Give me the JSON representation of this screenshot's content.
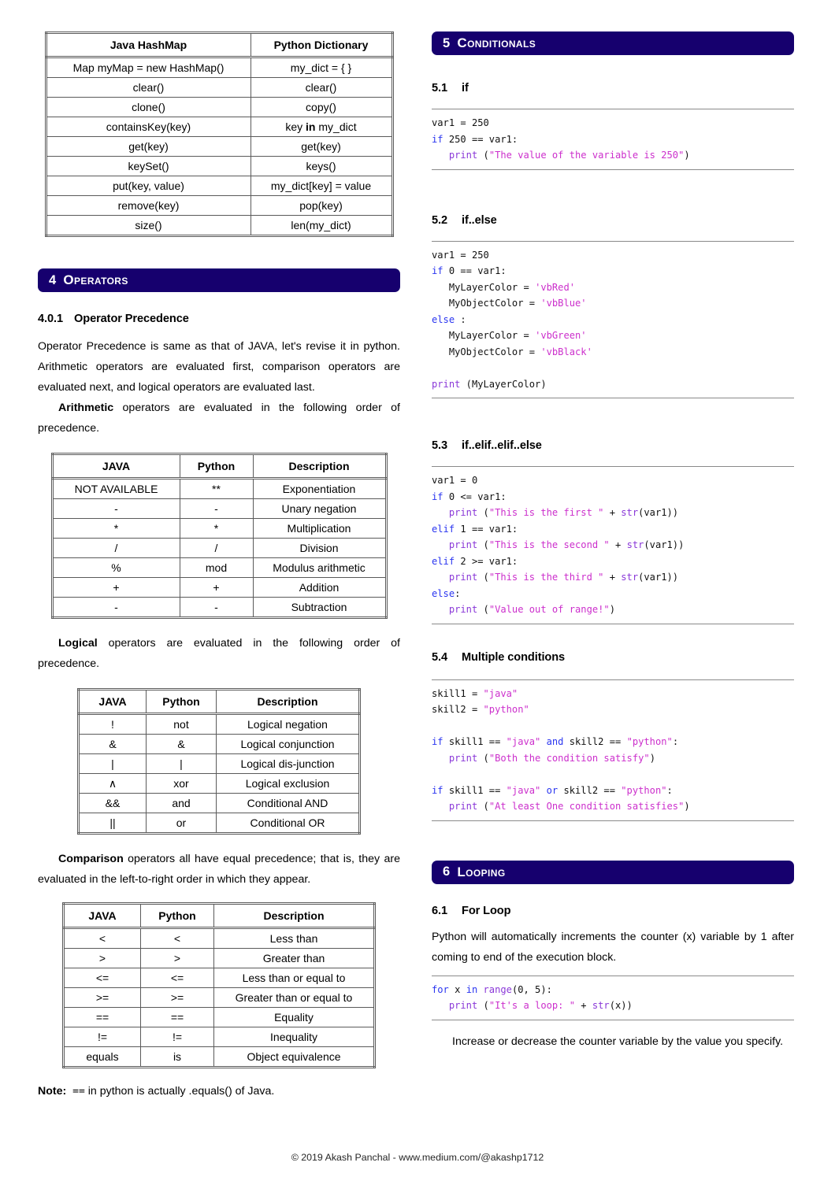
{
  "theme": {
    "header_bar_color": "#16006e",
    "header_text_color": "#ffffff",
    "code_keyword_color": "#2a35f0",
    "code_builtin_color": "#8a38d8",
    "code_string_color": "#cc2fcc",
    "table_border_color": "#5a5a5a"
  },
  "hashmap_table": {
    "headers": [
      "Java HashMap",
      "Python Dictionary"
    ],
    "rows": [
      [
        "Map myMap = new HashMap()",
        "my_dict = { }"
      ],
      [
        "clear()",
        "clear()"
      ],
      [
        "clone()",
        "copy()"
      ],
      [
        "containsKey(key)",
        "key in my_dict"
      ],
      [
        "get(key)",
        "get(key)"
      ],
      [
        "keySet()",
        "keys()"
      ],
      [
        "put(key, value)",
        "my_dict[key] = value"
      ],
      [
        "remove(key)",
        "pop(key)"
      ],
      [
        "size()",
        "len(my_dict)"
      ]
    ],
    "bold_word_row3": "in"
  },
  "section4": {
    "number": "4",
    "title": "Operators",
    "sub1": {
      "number": "4.0.1",
      "title": "Operator Precedence"
    },
    "para1": "Operator Precedence is same as that of JAVA, let's revise it in python. Arithmetic operators are evaluated first, comparison operators are evaluated next, and logical operators are evaluated last.",
    "para2_lead": "Arithmetic",
    "para2_rest": " operators are evaluated in the following order of precedence.",
    "para3_lead": "Logical",
    "para3_rest": " operators are evaluated in the following order of precedence.",
    "para4_lead": "Comparison",
    "para4_rest": " operators all have equal precedence; that is, they are evaluated in the left-to-right order in which they appear.",
    "note_label": "Note:",
    "note_code": "==",
    "note_rest": " in python is actually .equals() of Java."
  },
  "arithmetic_table": {
    "headers": [
      "JAVA",
      "Python",
      "Description"
    ],
    "rows": [
      [
        "NOT AVAILABLE",
        "**",
        "Exponentiation"
      ],
      [
        "-",
        "-",
        "Unary negation"
      ],
      [
        "*",
        "*",
        "Multiplication"
      ],
      [
        "/",
        "/",
        "Division"
      ],
      [
        "%",
        "mod",
        "Modulus arithmetic"
      ],
      [
        "+",
        "+",
        "Addition"
      ],
      [
        "-",
        "-",
        "Subtraction"
      ]
    ]
  },
  "logical_table": {
    "headers": [
      "JAVA",
      "Python",
      "Description"
    ],
    "rows": [
      [
        "!",
        "not",
        "Logical negation"
      ],
      [
        "&",
        "&",
        "Logical conjunction"
      ],
      [
        "|",
        "|",
        "Logical dis-junction"
      ],
      [
        "∧",
        "xor",
        "Logical exclusion"
      ],
      [
        "&&",
        "and",
        "Conditional AND"
      ],
      [
        "||",
        "or",
        "Conditional OR"
      ]
    ]
  },
  "comparison_table": {
    "headers": [
      "JAVA",
      "Python",
      "Description"
    ],
    "rows": [
      [
        "<",
        "<",
        "Less than"
      ],
      [
        ">",
        ">",
        "Greater than"
      ],
      [
        "<=",
        "<=",
        "Less than or equal to"
      ],
      [
        ">=",
        ">=",
        "Greater than or equal to"
      ],
      [
        "==",
        "==",
        "Equality"
      ],
      [
        "!=",
        "!=",
        "Inequality"
      ],
      [
        "equals",
        "is",
        "Object equivalence"
      ]
    ]
  },
  "section5": {
    "number": "5",
    "title": "Conditionals",
    "sub1": {
      "number": "5.1",
      "title": "if"
    },
    "sub2": {
      "number": "5.2",
      "title": "if..else"
    },
    "sub3": {
      "number": "5.3",
      "title": "if..elif..elif..else"
    },
    "sub4": {
      "number": "5.4",
      "title": "Multiple conditions"
    },
    "code1": "var1 = 250\nif 250 == var1:\n   print (\"The value of the variable is 250\")",
    "code2": "var1 = 250\nif 0 == var1:\n   MyLayerColor = 'vbRed'\n   MyObjectColor = 'vbBlue'\nelse :\n   MyLayerColor = 'vbGreen'\n   MyObjectColor = 'vbBlack'\n\nprint (MyLayerColor)",
    "code3": "var1 = 0\nif 0 <= var1:\n   print (\"This is the first \" + str(var1))\nelif 1 == var1:\n   print (\"This is the second \" + str(var1))\nelif 2 >= var1:\n   print (\"This is the third \" + str(var1))\nelse:\n   print (\"Value out of range!\")",
    "code4": "skill1 = \"java\"\nskill2 = \"python\"\n\nif skill1 == \"java\" and skill2 == \"python\":\n   print (\"Both the condition satisfy\")\n\nif skill1 == \"java\" or skill2 == \"python\":\n   print (\"At least One condition satisfies\")"
  },
  "section6": {
    "number": "6",
    "title": "Looping",
    "sub1": {
      "number": "6.1",
      "title": "For Loop"
    },
    "para1": "Python will automatically increments the counter (x) variable by 1 after coming to end of the execution block.",
    "code1": "for x in range(0, 5):\n   print (\"It's a loop: \" + str(x))",
    "para2": "Increase or decrease the counter variable by the value you specify."
  },
  "footer": {
    "text": "© 2019  Akash Panchal - www.medium.com/@akashp1712"
  }
}
